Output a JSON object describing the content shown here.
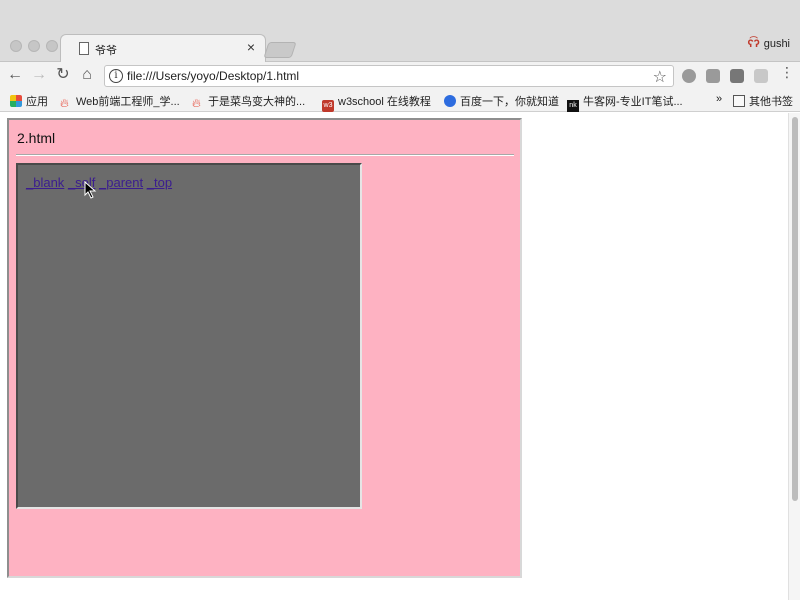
{
  "browser": {
    "tab": {
      "title": "爷爷"
    },
    "profile_name": "gushi",
    "address_bar": {
      "url": "file:///Users/yoyo/Desktop/1.html"
    }
  },
  "bookmarks": [
    {
      "label": "应用",
      "icon": "apps-grid-icon"
    },
    {
      "label": "Web前端工程师_学...",
      "icon": "flame-icon"
    },
    {
      "label": "于是菜鸟变大神的...",
      "icon": "flame-icon"
    },
    {
      "label": "w3school 在线教程",
      "icon": "w3-icon"
    },
    {
      "label": "百度一下，你就知道",
      "icon": "paw-icon"
    },
    {
      "label": "牛客网-专业IT笔试...",
      "icon": "nowcoder-icon"
    }
  ],
  "bookmarks_overflow": "»",
  "other_bookmarks": "其他书签",
  "page": {
    "frame_heading": "2.html",
    "links": [
      "_blank",
      "_self",
      "_parent",
      "_top"
    ]
  },
  "colors": {
    "outer_frame_bg": "#feb2c2",
    "inner_frame_bg": "#6b6b6b",
    "link_color": "#3b1d8f"
  }
}
